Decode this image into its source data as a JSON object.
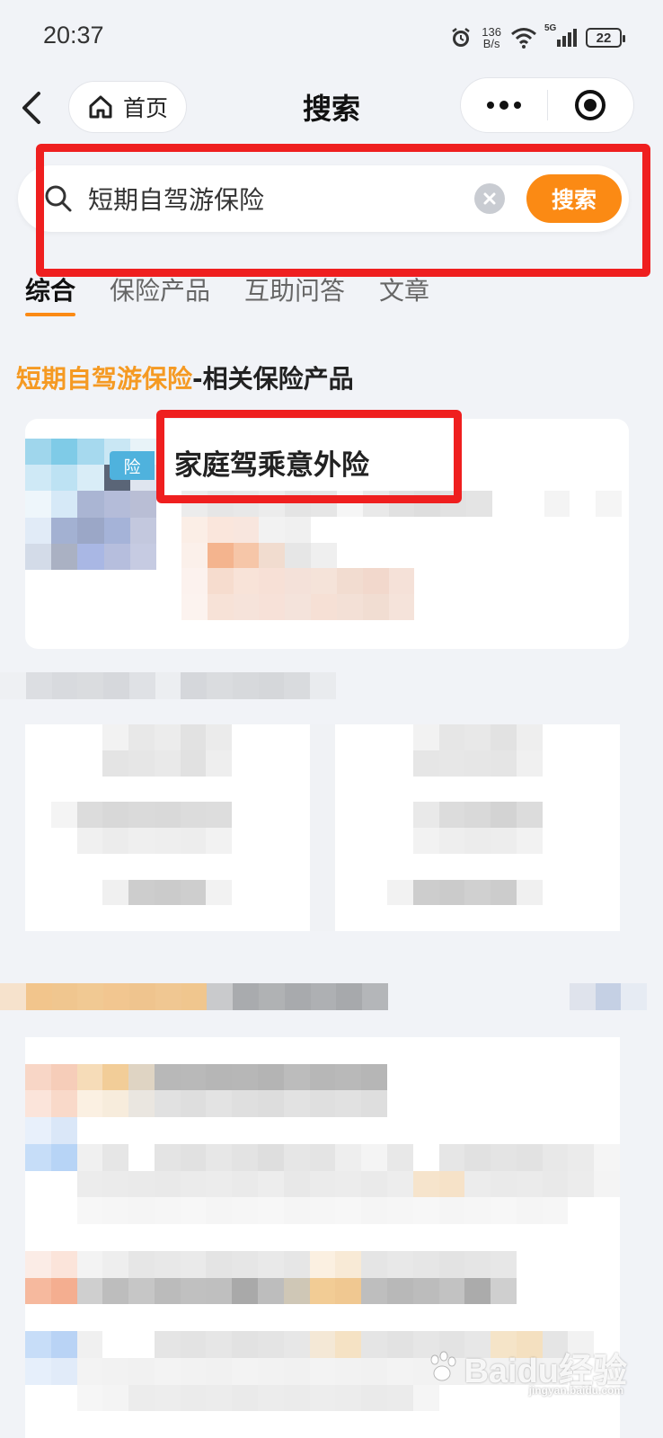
{
  "status_bar": {
    "time": "20:37",
    "speed_value": "136",
    "speed_unit": "B/s",
    "network": "5G",
    "battery": "22"
  },
  "nav": {
    "home_label": "首页",
    "title": "搜索"
  },
  "search": {
    "query": "短期自驾游保险",
    "button_label": "搜索"
  },
  "tabs": [
    {
      "label": "综合",
      "active": true
    },
    {
      "label": "保险产品",
      "active": false
    },
    {
      "label": "互助问答",
      "active": false
    },
    {
      "label": "文章",
      "active": false
    }
  ],
  "section": {
    "keyword": "短期自驾游保险",
    "suffix": "-相关保险产品"
  },
  "product": {
    "tag": "险",
    "title": "家庭驾乘意外险"
  },
  "watermark": {
    "text": "Baidu经验",
    "sub": "jingyan.baidu.com"
  },
  "colors": {
    "accent": "#fb8a14",
    "keyword": "#f59a23",
    "highlight": "#ef1f1f"
  }
}
